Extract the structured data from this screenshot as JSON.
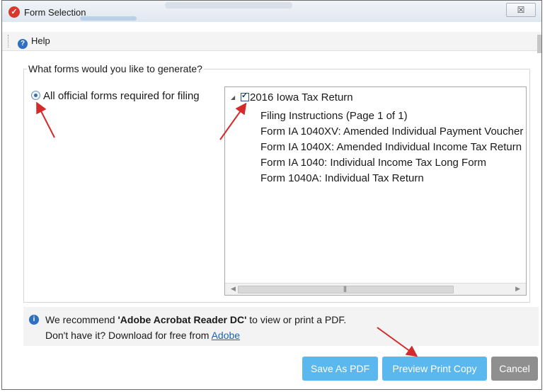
{
  "window": {
    "title": "Form Selection",
    "close_glyph": "☒",
    "app_icon": "check-icon"
  },
  "menu": {
    "help_label": "Help",
    "help_icon": "help-icon"
  },
  "form_group": {
    "legend": "What forms would you like to generate?",
    "radio_label": "All official forms required for filing"
  },
  "tree": {
    "root_label": "2016 Iowa Tax Return",
    "root_checked": true,
    "children": [
      "Filing Instructions (Page 1 of 1)",
      "Form IA 1040XV: Amended Individual Payment Voucher",
      "Form IA 1040X: Amended Individual Income Tax Return",
      "Form IA 1040: Individual Income Tax Long Form",
      "Form 1040A: Individual Tax Return"
    ]
  },
  "info": {
    "recommend_prefix": "We recommend ",
    "recommend_app": "'Adobe Acrobat Reader DC'",
    "recommend_suffix": " to view or print a PDF.",
    "download_prefix": "Don't have it? Download for free from ",
    "download_link": "Adobe"
  },
  "buttons": {
    "save_pdf": "Save As PDF",
    "preview": "Preview Print Copy",
    "cancel": "Cancel"
  },
  "colors": {
    "primary_button": "#5bb8ee",
    "cancel_button": "#8f8f8f",
    "annotation_arrow": "#d42a2a",
    "link": "#1f5fb8"
  }
}
